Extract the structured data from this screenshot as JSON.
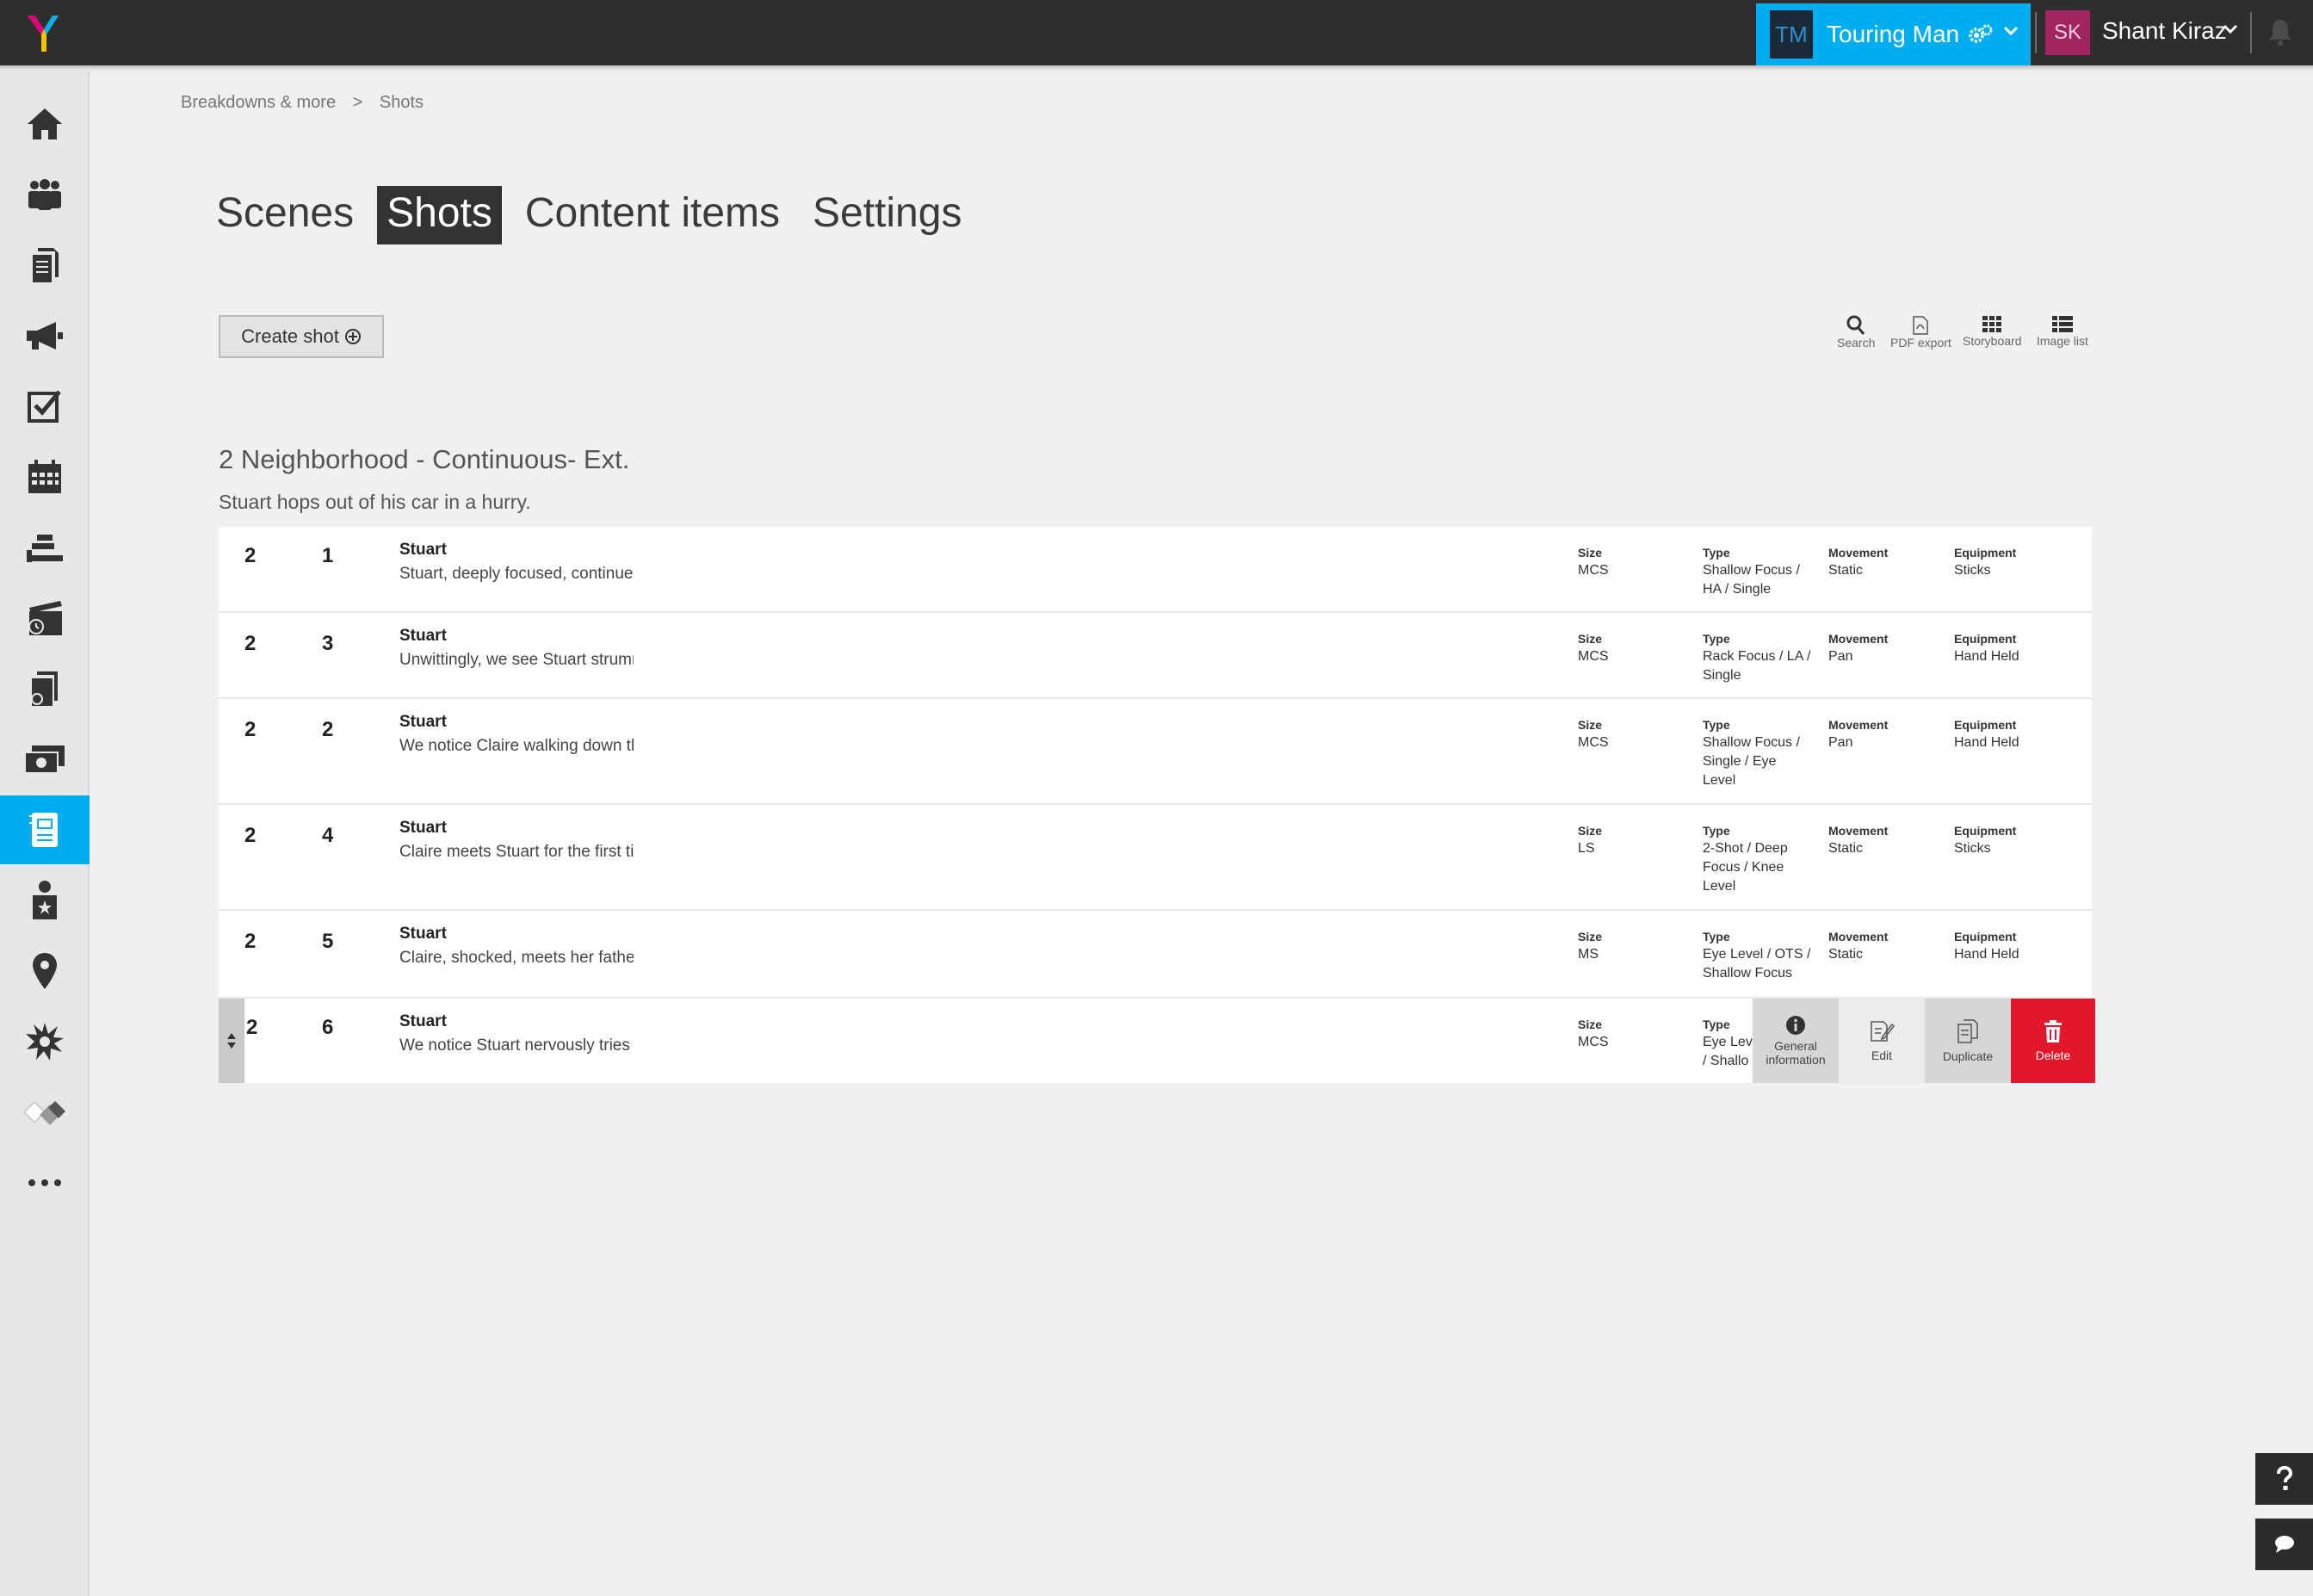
{
  "topbar": {
    "project_initials": "TM",
    "project_name": "Touring Man",
    "user_initials": "SK",
    "user_name": "Shant Kiraz"
  },
  "breadcrumb": {
    "parent": "Breakdowns & more",
    "separator": ">",
    "current": "Shots"
  },
  "tabs": [
    "Scenes",
    "Shots",
    "Content items",
    "Settings"
  ],
  "toolbar": {
    "create_label": "Create shot",
    "search_label": "Search",
    "pdf_label": "PDF export",
    "storyboard_label": "Storyboard",
    "imagelist_label": "Image list"
  },
  "scene": {
    "title": "2 Neighborhood - Continuous- Ext.",
    "description": "Stuart hops out of his car in a hurry."
  },
  "labels": {
    "size": "Size",
    "type": "Type",
    "movement": "Movement",
    "equipment": "Equipment"
  },
  "shots": [
    {
      "scene": "2",
      "shot": "1",
      "character": "Stuart",
      "description": "Stuart, deeply focused, continues",
      "size": "MCS",
      "type": "Shallow Focus / HA / Single",
      "movement": "Static",
      "equipment": "Sticks"
    },
    {
      "scene": "2",
      "shot": "3",
      "character": "Stuart",
      "description": "Unwittingly, we see Stuart strumm",
      "size": "MCS",
      "type": "Rack Focus / LA / Single",
      "movement": "Pan",
      "equipment": "Hand Held"
    },
    {
      "scene": "2",
      "shot": "2",
      "character": "Stuart",
      "description": "We notice Claire walking down the",
      "size": "MCS",
      "type": "Shallow Focus / Single / Eye Level",
      "movement": "Pan",
      "equipment": "Hand Held"
    },
    {
      "scene": "2",
      "shot": "4",
      "character": "Stuart",
      "description": "Claire meets Stuart for the first tir",
      "size": "LS",
      "type": "2-Shot / Deep Focus / Knee Level",
      "movement": "Static",
      "equipment": "Sticks"
    },
    {
      "scene": "2",
      "shot": "5",
      "character": "Stuart",
      "description": "Claire, shocked, meets her father",
      "size": "MS",
      "type": "Eye Level / OTS / Shallow Focus",
      "movement": "Static",
      "equipment": "Hand Held"
    },
    {
      "scene": "2",
      "shot": "6",
      "character": "Stuart",
      "description": "We notice Stuart nervously tries to",
      "size": "MCS",
      "type": "Eye Lev / Shallo"
    }
  ],
  "row_actions": {
    "info_label": "General information",
    "edit_label": "Edit",
    "duplicate_label": "Duplicate",
    "delete_label": "Delete"
  },
  "colors": {
    "accent": "#00aeef",
    "topbar": "#2e2e2e",
    "delete": "#e3162b",
    "project_avatar": "#1b2a38",
    "user_avatar": "#a0245e"
  },
  "icons": [
    "home-icon",
    "team-icon",
    "documents-icon",
    "megaphone-icon",
    "checklist-icon",
    "calendar-icon",
    "gantt-icon",
    "clapperboard-icon",
    "script-icon",
    "budget-icon",
    "breakdown-icon",
    "actor-icon",
    "location-pin-icon",
    "effects-icon",
    "link-icon",
    "more-icon"
  ]
}
